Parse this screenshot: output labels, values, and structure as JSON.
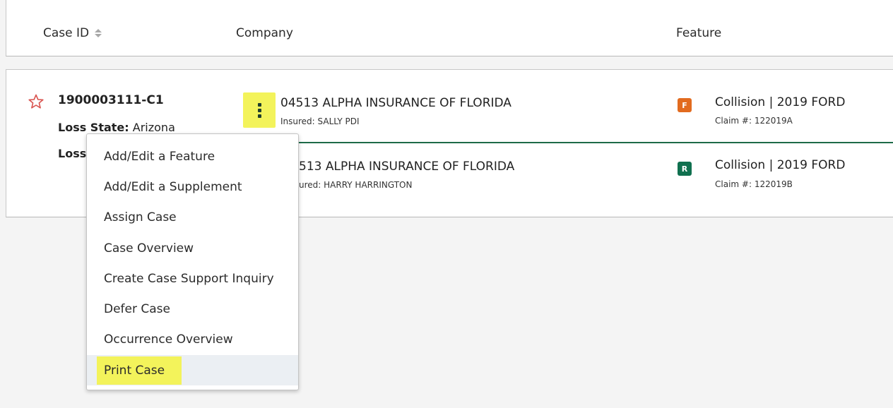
{
  "table": {
    "headers": {
      "case_id": "Case ID",
      "company": "Company",
      "feature": "Feature"
    }
  },
  "case": {
    "id": "1900003111-C1",
    "loss_state_label": "Loss State:",
    "loss_state_value": "Arizona",
    "loss_partial_label": "Loss",
    "rows": [
      {
        "company": "04513 ALPHA INSURANCE OF FLORIDA",
        "insured": "Insured: SALLY PDI",
        "badge": "F",
        "badge_color": "#e26b1f",
        "feature": "Collision | 2019 FORD",
        "claim": "Claim #: 122019A"
      },
      {
        "company_visible": "513 ALPHA INSURANCE OF FLORIDA",
        "insured_visible": "ured: HARRY HARRINGTON",
        "badge": "R",
        "badge_color": "#10704f",
        "feature": "Collision | 2019 FORD",
        "claim": "Claim #: 122019B"
      }
    ]
  },
  "menu": {
    "items": [
      "Add/Edit a Feature",
      "Add/Edit a Supplement",
      "Assign Case",
      "Case Overview",
      "Create Case Support Inquiry",
      "Defer Case",
      "Occurrence Overview",
      "Print Case"
    ],
    "highlighted_item": "Print Case"
  },
  "colors": {
    "highlight": "#f3f35b",
    "separator": "#1e6b49",
    "star": "#d9534f"
  },
  "icons": {
    "favorite": "star-outline-icon",
    "sort": "sort-icon",
    "actions": "kebab-menu-icon"
  }
}
